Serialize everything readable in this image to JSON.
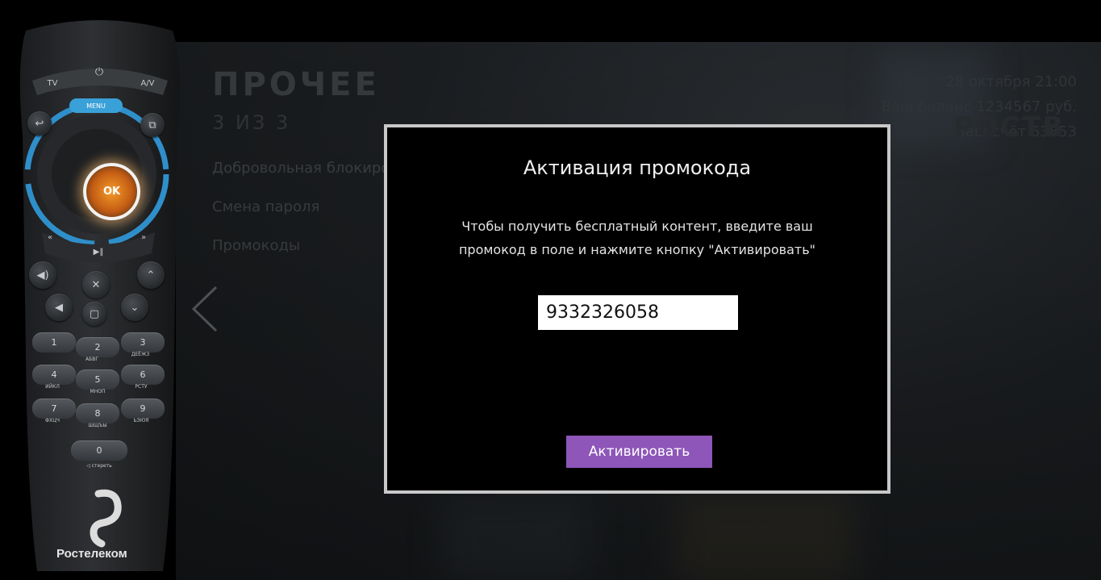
{
  "screen": {
    "section_title": "ПРОЧЕЕ",
    "section_page": "3 ИЗ 3",
    "menu": [
      {
        "label": "Добровольная блокировка"
      },
      {
        "label": "Смена пароля"
      },
      {
        "label": "Промокоды"
      }
    ],
    "datetime": "28 октября  21:00",
    "balance": "Ваш баланс  1234567 руб.",
    "account": "Ваш счёт  63853",
    "logo": "РОСТВ"
  },
  "remote": {
    "brand": "Ростелеком",
    "ok_label": "OK",
    "top_buttons": [
      "TV",
      "⏻",
      "A/V"
    ],
    "menu_label": "MENU",
    "numbers": [
      {
        "digit": "1",
        "sub": ""
      },
      {
        "digit": "2",
        "sub": "АБВГ"
      },
      {
        "digit": "3",
        "sub": "ДЕЁЖЗ"
      },
      {
        "digit": "4",
        "sub": "ИЙКЛ"
      },
      {
        "digit": "5",
        "sub": "МНОП"
      },
      {
        "digit": "6",
        "sub": "РСТУ"
      },
      {
        "digit": "7",
        "sub": "ФХЦЧ"
      },
      {
        "digit": "8",
        "sub": "ШЩЪЫ"
      },
      {
        "digit": "9",
        "sub": "ЬЭЮЯ"
      },
      {
        "digit": "0",
        "sub": ""
      }
    ],
    "zero_sub": "◁ стереть"
  },
  "dialog": {
    "title": "Активация промокода",
    "message_line1": "Чтобы получить бесплатный контент, введите ваш",
    "message_line2": "промокод в поле и нажмите кнопку \"Активировать\"",
    "promo_value": "9332326058",
    "activate_label": "Активировать"
  },
  "colors": {
    "activate_button": "#8d56b8",
    "dialog_border": "#c8c8c8",
    "ok_glow": "#f59b2b",
    "remote_ring": "#3aa0d8"
  }
}
